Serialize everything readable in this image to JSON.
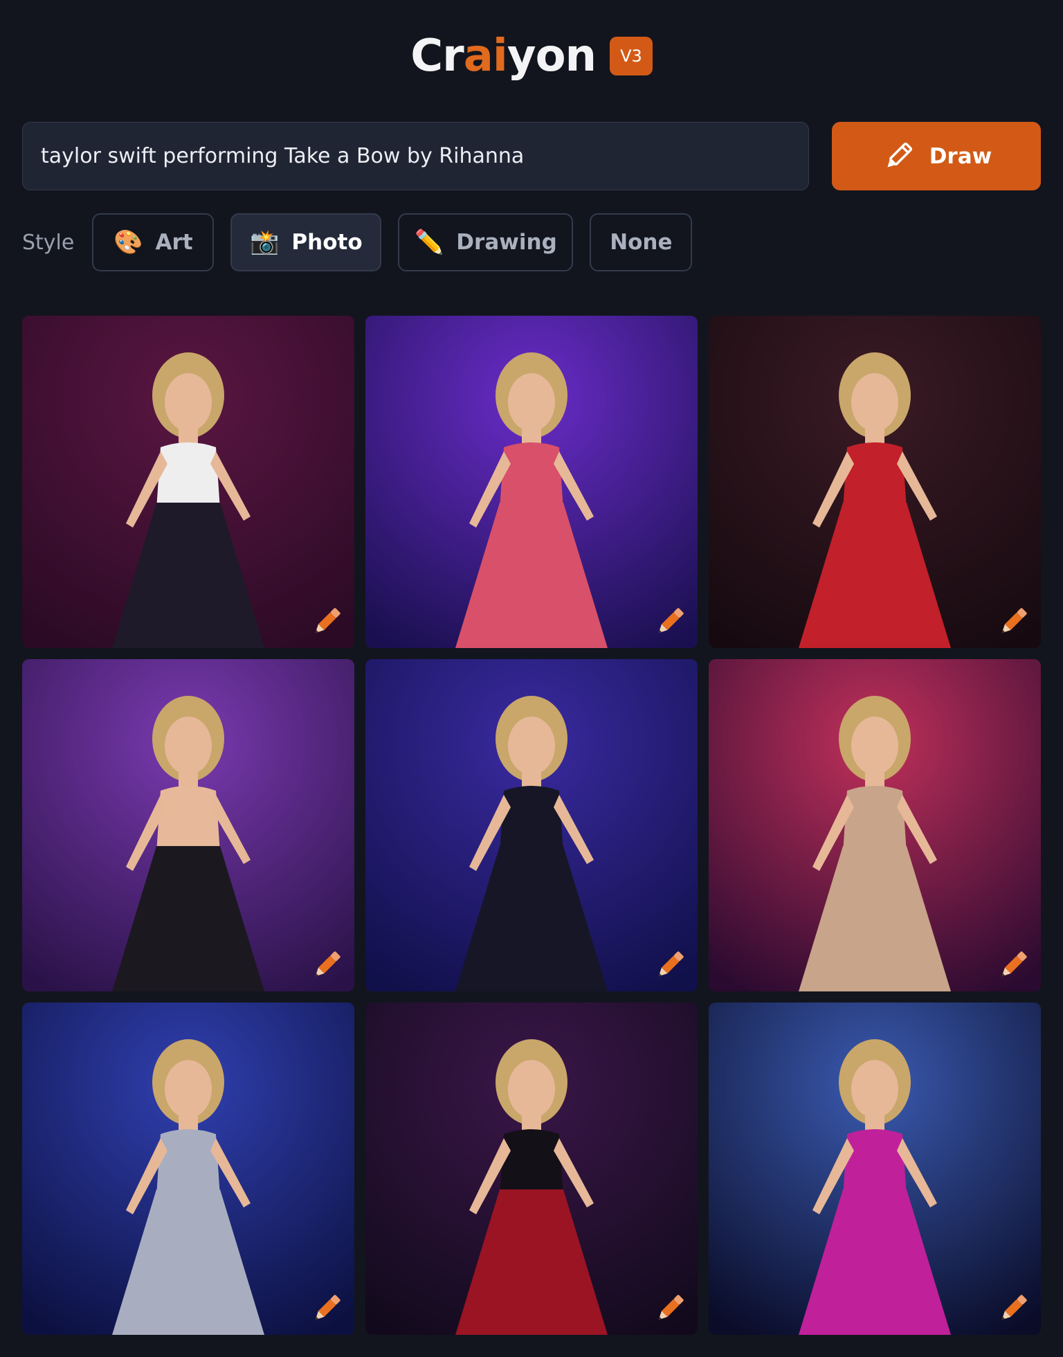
{
  "header": {
    "logo_parts": [
      "Cr",
      "ai",
      "yon"
    ],
    "version_badge": "V3"
  },
  "search": {
    "value": "taylor swift performing Take a Bow by Rihanna"
  },
  "draw_button": {
    "label": "Draw",
    "icon": "pencil-icon"
  },
  "style": {
    "label": "Style",
    "options": [
      {
        "emoji": "🎨",
        "label": "Art"
      },
      {
        "emoji": "📸",
        "label": "Photo"
      },
      {
        "emoji": "✏️",
        "label": "Drawing"
      },
      {
        "emoji": "",
        "label": "None"
      }
    ],
    "selected": "Photo"
  },
  "colors": {
    "background": "#12151e",
    "accent": "#d25a16",
    "input_bg": "#202534"
  },
  "results": [
    {
      "bg1": "#5a1642",
      "bg2": "#2a0a24",
      "dress": "#1e1a2a",
      "top": "#eeeeee"
    },
    {
      "bg1": "#6a2cc8",
      "bg2": "#1a1050",
      "dress": "#d8506a",
      "top": "#d8506a"
    },
    {
      "bg1": "#3a1a24",
      "bg2": "#160a10",
      "dress": "#c2202a",
      "top": "#c2202a"
    },
    {
      "bg1": "#7a3ab0",
      "bg2": "#2a1248",
      "dress": "#1c1820",
      "top": "#e8b89a"
    },
    {
      "bg1": "#3a2aa0",
      "bg2": "#10104a",
      "dress": "#161626",
      "top": "#161626"
    },
    {
      "bg1": "#c0305a",
      "bg2": "#2a0a30",
      "dress": "#c8a48a",
      "top": "#c8a48a"
    },
    {
      "bg1": "#3040b0",
      "bg2": "#0c1040",
      "dress": "#a8aec0",
      "top": "#a8aec0"
    },
    {
      "bg1": "#3a1648",
      "bg2": "#120a1c",
      "dress": "#9a1424",
      "top": "#141018"
    },
    {
      "bg1": "#3a5ab0",
      "bg2": "#0a0c28",
      "dress": "#c0209a",
      "top": "#c0209a"
    }
  ]
}
